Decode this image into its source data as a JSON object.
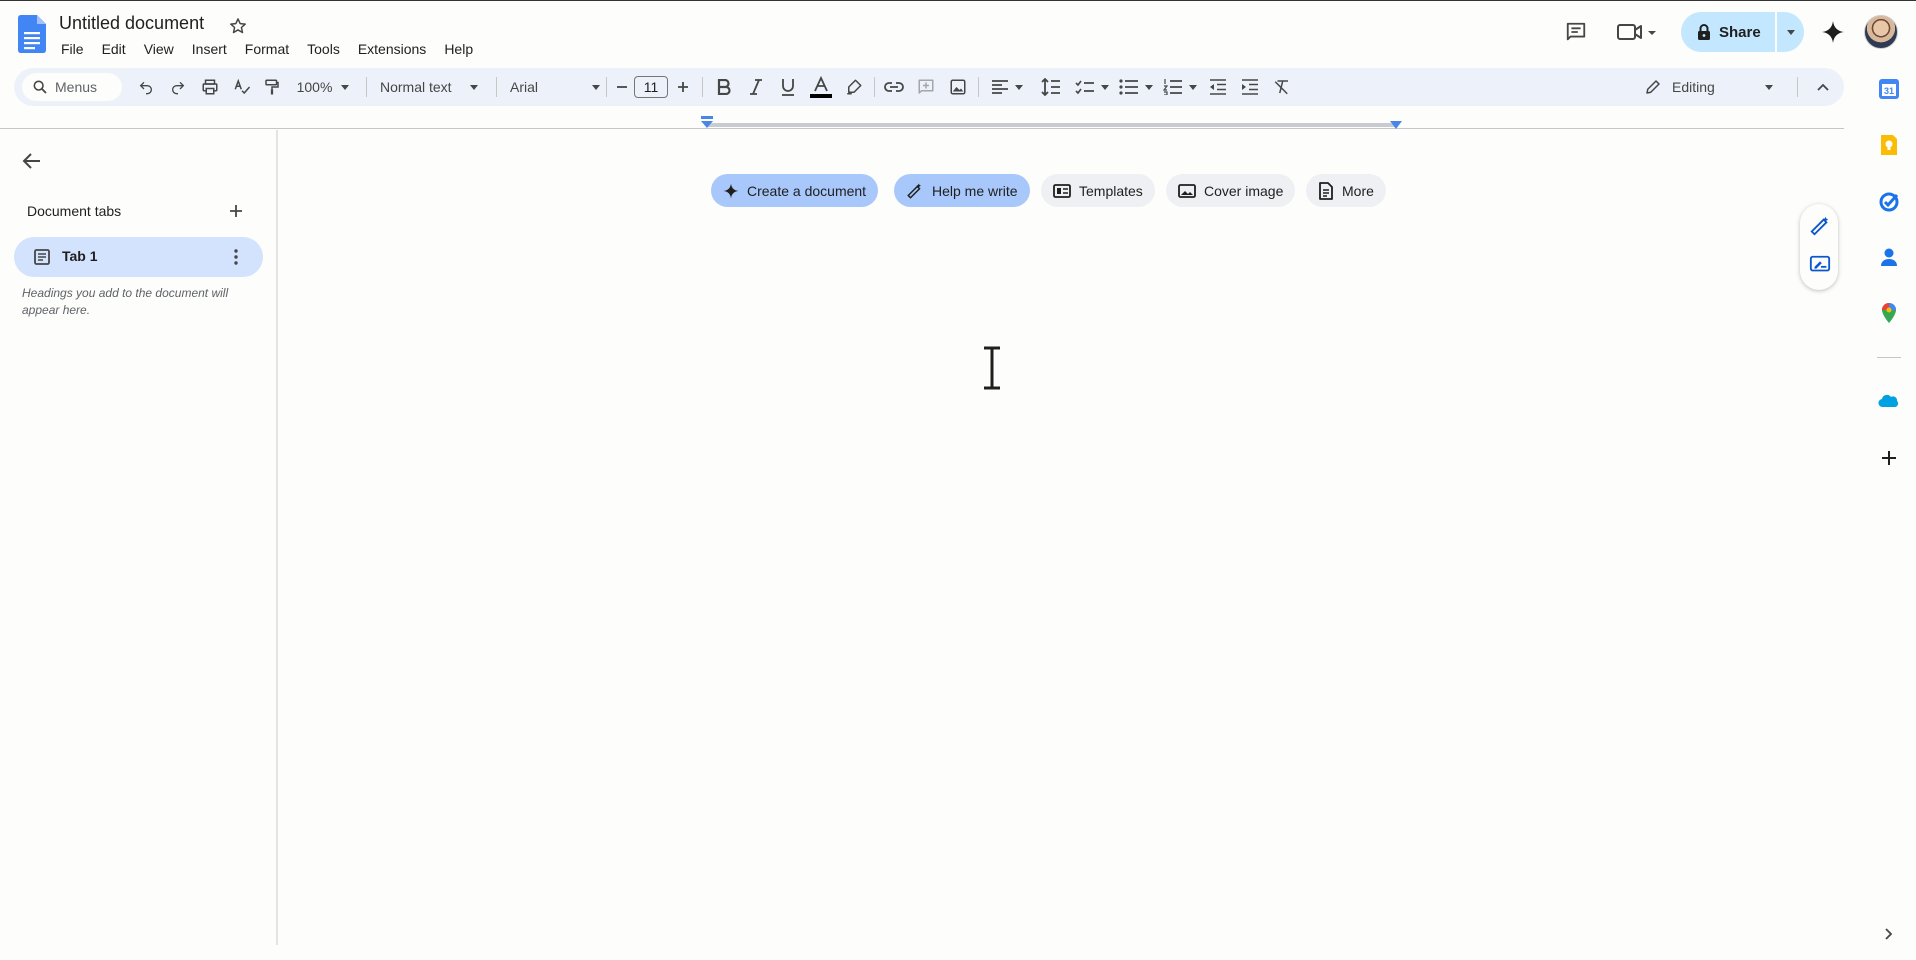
{
  "header": {
    "title": "Untitled document",
    "menus": [
      "File",
      "Edit",
      "View",
      "Insert",
      "Format",
      "Tools",
      "Extensions",
      "Help"
    ],
    "share_label": "Share"
  },
  "toolbar": {
    "search_placeholder": "Menus",
    "zoom": "100%",
    "style": "Normal text",
    "font": "Arial",
    "font_size": "11",
    "mode": "Editing"
  },
  "sidebar": {
    "section_title": "Document tabs",
    "tabs": [
      {
        "label": "Tab 1"
      }
    ],
    "hint": "Headings you add to the document will appear here."
  },
  "chips": {
    "create": "Create a document",
    "help": "Help me write",
    "templates": "Templates",
    "cover": "Cover image",
    "more": "More"
  },
  "colors": {
    "accent": "#0b57d0",
    "share_bg": "#c2e7ff",
    "toolbar_bg": "#edf2fa",
    "active_tab": "#d3e3fd",
    "chip_blue": "#a8c7fa"
  }
}
